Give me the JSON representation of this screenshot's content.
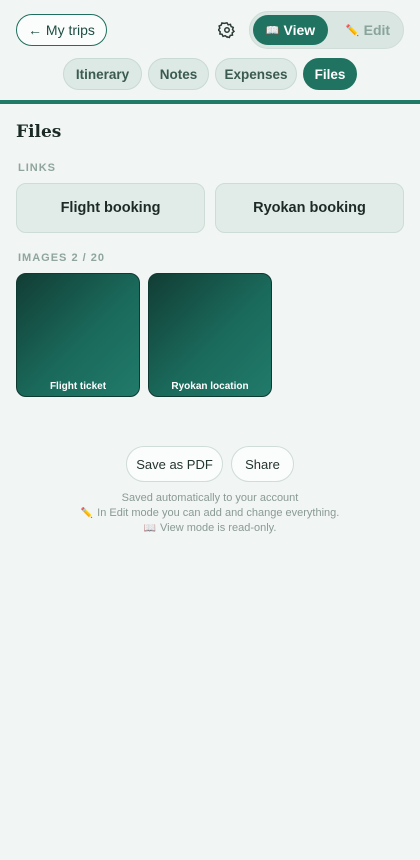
{
  "header": {
    "back_label": "← My trips",
    "settings_icon": "gear-icon",
    "mode": {
      "view_label": "View",
      "view_icon": "book-icon",
      "edit_label": "Edit",
      "edit_icon": "pencil-icon",
      "selected": "View"
    }
  },
  "tabs": [
    {
      "label": "Itinerary"
    },
    {
      "label": "Notes"
    },
    {
      "label": "Expenses"
    },
    {
      "label": "Files",
      "active": true
    }
  ],
  "main": {
    "title": "Files",
    "links_label": "LINKS",
    "links": [
      {
        "label": "Flight booking"
      },
      {
        "label": "Ryokan booking"
      }
    ],
    "images_label": "IMAGES 2 / 20",
    "images": [
      {
        "caption": "Flight ticket"
      },
      {
        "caption": "Ryokan location"
      }
    ]
  },
  "footer": {
    "save_pdf_label": "Save as PDF",
    "share_label": "Share",
    "note1": "Saved automatically to your account",
    "note2": "In Edit mode you can add and change everything.",
    "note3": "View mode is read-only."
  },
  "colors": {
    "accent": "#1f7360",
    "background": "#f1f5f3"
  }
}
